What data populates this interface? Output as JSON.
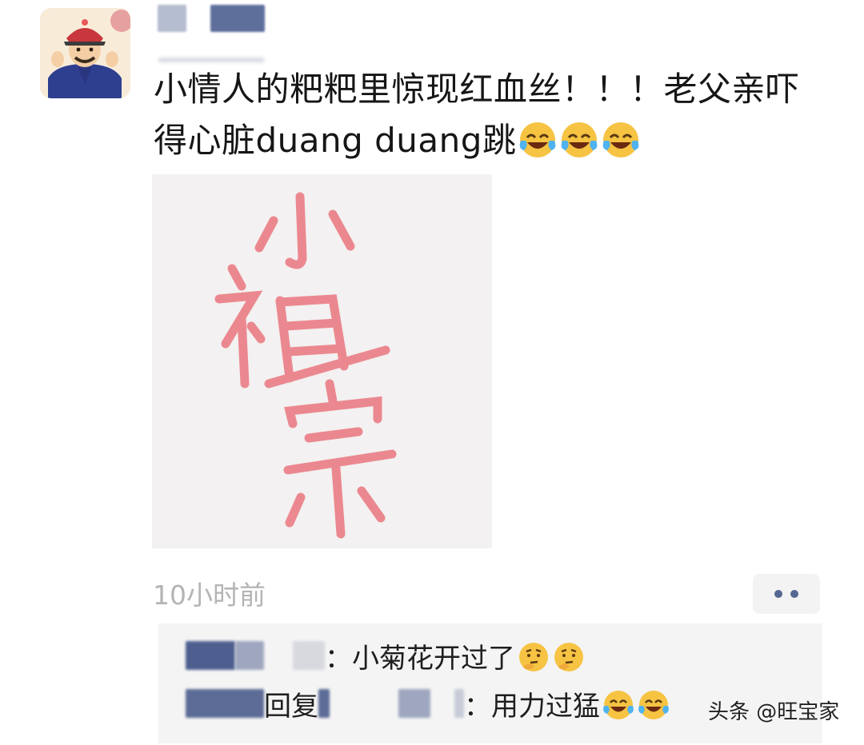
{
  "post": {
    "text": "小情人的粑粑里惊现红血丝！！！老父亲吓得心脏duang duang跳",
    "emojis": [
      "laughing-crying-face",
      "laughing-crying-face",
      "laughing-crying-face"
    ],
    "image_text": "小祖宗",
    "timestamp": "10小时前"
  },
  "comments": [
    {
      "text": "：小菊花开过了",
      "emojis": [
        "thinking-face",
        "thinking-face"
      ]
    },
    {
      "reply_label": "回复",
      "text": "：用力过猛",
      "emojis": [
        "laughing-crying-face",
        "laughing-crying-face"
      ]
    }
  ],
  "watermark": "头条 @旺宝家",
  "colors": {
    "accent": "#566892",
    "timestamp": "#b4b4b4",
    "image_ink": "#e8707a"
  }
}
